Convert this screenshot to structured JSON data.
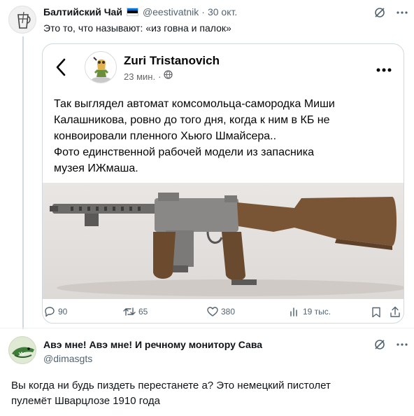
{
  "tweet": {
    "author_name": "Балтийский Чай",
    "handle": "@eestivatnik",
    "separator": "·",
    "date": "30 окт.",
    "text": "Это то, что называют: «из говна и палок»"
  },
  "quoted_post": {
    "author_name": "Zuri Tristanovich",
    "time": "23 мин.",
    "separator": "·",
    "text_lines": [
      "Так выглядел автомат комсомольца-самородка Миши",
      "Калашникова, ровно до того дня, когда к ним в КБ не",
      "конвоировали пленного Хьюго Шмайсера..",
      "Фото единственной рабочей модели из запасника",
      "музея ИЖмаша."
    ],
    "stats": {
      "replies": "90",
      "retweets": "65",
      "likes": "380",
      "views": "19 тыс."
    }
  },
  "reply": {
    "author_name": "Авэ мне! Авэ мне! И речному монитору Сава",
    "handle": "@dimasgts",
    "text_lines": [
      "Вы когда ни будь пиздеть перестанете а? Это немецкий пистолет",
      "пулемёт Шварцлозе 1910 года"
    ]
  },
  "colors": {
    "text": "#0f1419",
    "muted": "#536471",
    "border": "#cfd9de",
    "fb_text": "#050505",
    "fb_meta": "#65676b",
    "estonia_flag": [
      "#0072ce",
      "#000000",
      "#ffffff"
    ]
  },
  "icons": [
    "grok-icon",
    "more-icon",
    "back-arrow-icon",
    "globe-icon",
    "reply-icon",
    "retweet-icon",
    "like-icon",
    "views-icon",
    "bookmark-icon",
    "share-icon",
    "flag-icon"
  ]
}
